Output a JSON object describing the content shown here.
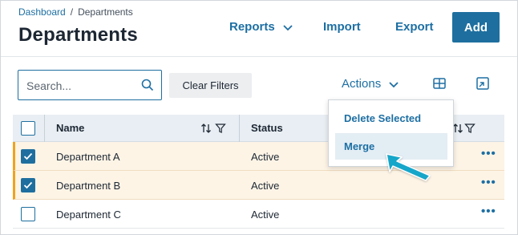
{
  "breadcrumb": {
    "home": "Dashboard",
    "separator": "/",
    "current": "Departments"
  },
  "page_title": "Departments",
  "header_actions": {
    "reports": "Reports",
    "import": "Import",
    "export": "Export",
    "add": "Add"
  },
  "toolbar": {
    "search_placeholder": "Search...",
    "clear_filters": "Clear Filters",
    "actions": "Actions"
  },
  "table": {
    "columns": {
      "name": "Name",
      "status": "Status"
    },
    "rows": [
      {
        "name": "Department A",
        "status": "Active",
        "checked": true
      },
      {
        "name": "Department B",
        "status": "Active",
        "checked": true
      },
      {
        "name": "Department C",
        "status": "Active",
        "checked": false
      }
    ],
    "row_menu": "•••"
  },
  "actions_menu": {
    "items": [
      "Delete Selected",
      "Merge"
    ],
    "hovered": "Merge"
  },
  "colors": {
    "accent": "#1e6f9f",
    "selection_bar": "#f0a21d",
    "pointer": "#18a6c9"
  }
}
